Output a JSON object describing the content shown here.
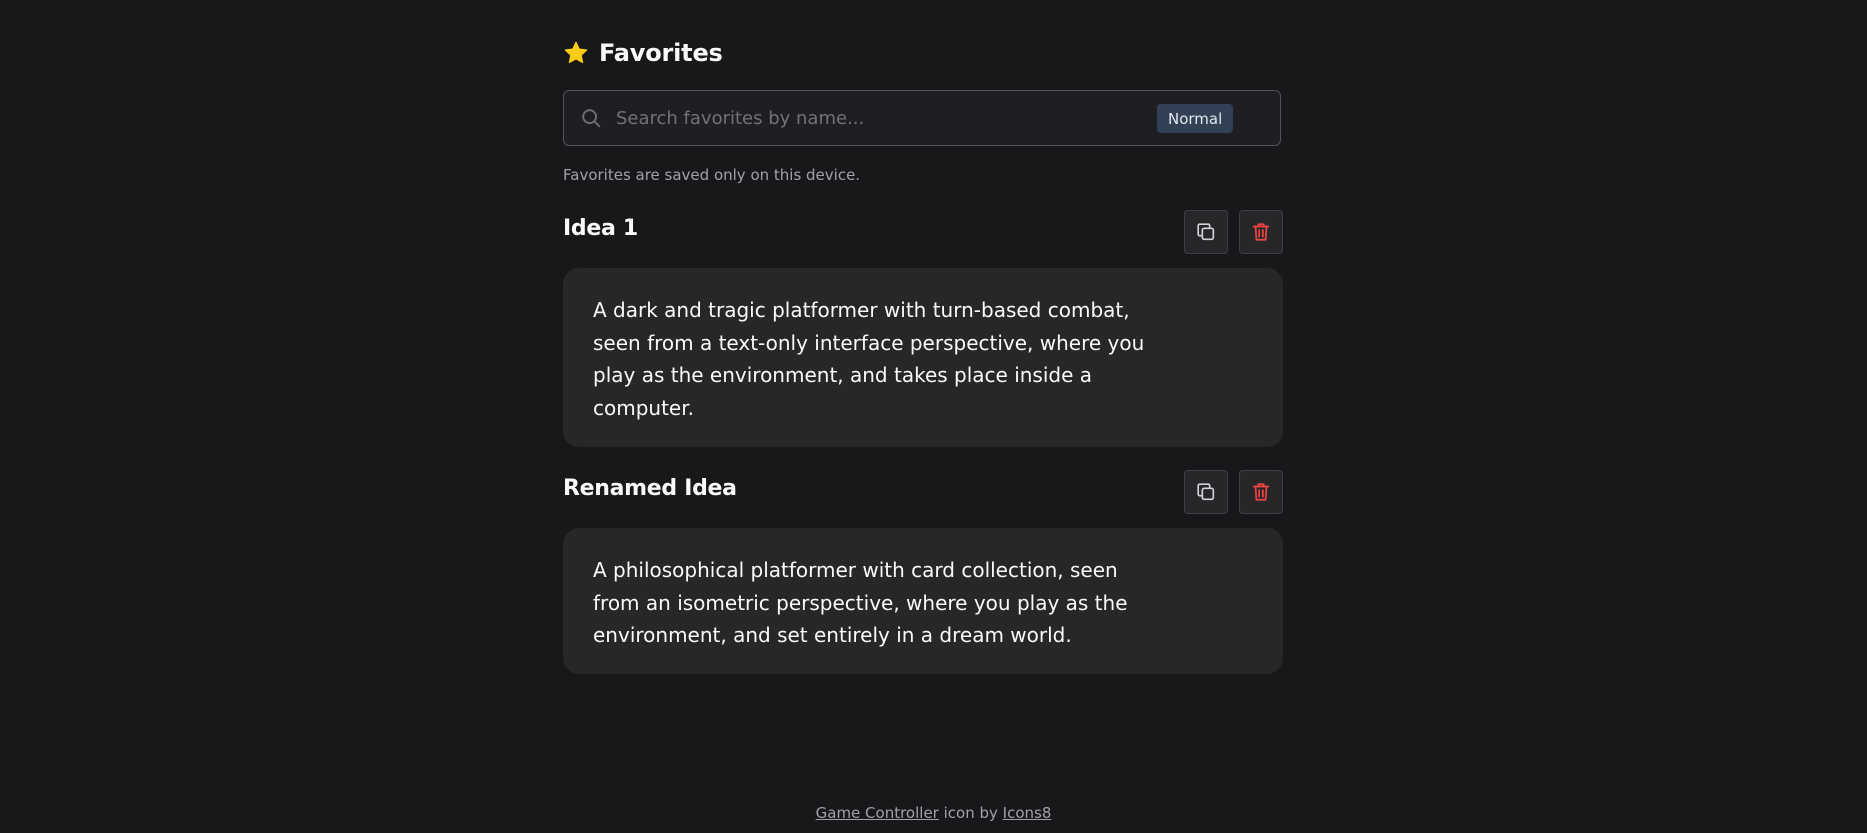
{
  "header": {
    "title": "Favorites",
    "icon": "star-icon",
    "icon_color": "#facc15"
  },
  "search": {
    "placeholder": "Search favorites by name...",
    "value": "",
    "badge": "Normal"
  },
  "note": "Favorites are saved only on this device.",
  "favorites": [
    {
      "title": "Idea 1",
      "description": "A dark and tragic platformer with turn-based combat, seen from a text-only interface perspective, where you play as the environment, and takes place inside a computer."
    },
    {
      "title": "Renamed Idea",
      "description": "A philosophical platformer with card collection, seen from an isometric perspective, where you play as the environment, and set entirely in a dream world."
    }
  ],
  "footer": {
    "link1": "Game Controller",
    "middle": " icon by ",
    "link2": "Icons8"
  },
  "colors": {
    "background": "#18181b",
    "card": "#27272a",
    "delete": "#ef4444",
    "badge_bg": "#334155"
  }
}
